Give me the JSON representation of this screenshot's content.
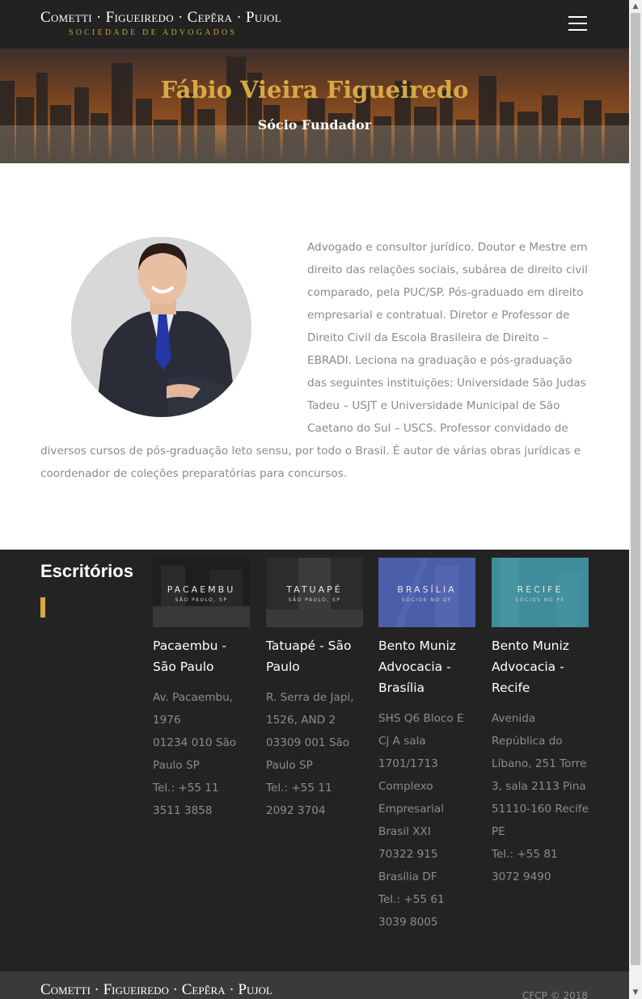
{
  "header": {
    "logo_main": "Cometti · Figueiredo · Cepêra · Pujol",
    "logo_sub": "SOCIEDADE DE ADVOGADOS",
    "menu_icon": "hamburger-menu-icon"
  },
  "hero": {
    "name": "Fábio Vieira Figueiredo",
    "role": "Sócio Fundador"
  },
  "bio": {
    "text": "Advogado e consultor jurídico. Doutor e Mestre em direito das relações sociais, subárea de direito civil comparado, pela PUC/SP. Pós-graduado em direito empresarial e contratual. Diretor e Professor de Direito Civil da Escola Brasileira de Direito – EBRADI. Leciona na graduação e pós-graduação das seguintes instituições: Universidade São Judas Tadeu – USJT e Universidade Municipal de São Caetano do Sul – USCS. Professor convidado de diversos cursos de pós-graduação leto sensu, por todo o Brasil. É autor de várias obras jurídicas e coordenador de coleções preparatórias para concursos."
  },
  "offices": {
    "title": "Escritórios",
    "items": [
      {
        "image_label": "PACAEMBU",
        "image_sub": "SÃO PAULO, SP",
        "name": "Pacaembu - São Paulo",
        "address": "Av. Pacaembu, 1976\n01234 010 São Paulo SP\nTel.: +55 11 3511 3858",
        "color": "#2a2a2a"
      },
      {
        "image_label": "TATUAPÉ",
        "image_sub": "SÃO PAULO, SP",
        "name": "Tatuapé - São Paulo",
        "address": "R. Serra de Japi, 1526, AND 2\n03309 001 São Paulo SP\nTel.: +55 11 2092 3704",
        "color": "#333333"
      },
      {
        "image_label": "BRASÍLIA",
        "image_sub": "SÓCIOS NO DF",
        "name": "Bento Muniz Advocacia - Brasília",
        "address": "SHS Q6 Bloco E Cj A sala 1701/1713\nComplexo Empresarial Brasil XXI\n70322 915 Brasília DF\nTel.: +55 61 3039 8005",
        "color": "#4a5ea8"
      },
      {
        "image_label": "RECIFE",
        "image_sub": "SÓCIOS NO PE",
        "name": "Bento Muniz Advocacia - Recife",
        "address": "Avenida República do Líbano, 251 Torre 3, sala 2113 Pina\n51110-160 Recife PE\nTel.: +55 81 3072 9490",
        "color": "#3f8e9c"
      }
    ]
  },
  "footer": {
    "logo": "Cometti · Figueiredo · Cepêra · Pujol",
    "copyright": "CFCP © 2018"
  }
}
